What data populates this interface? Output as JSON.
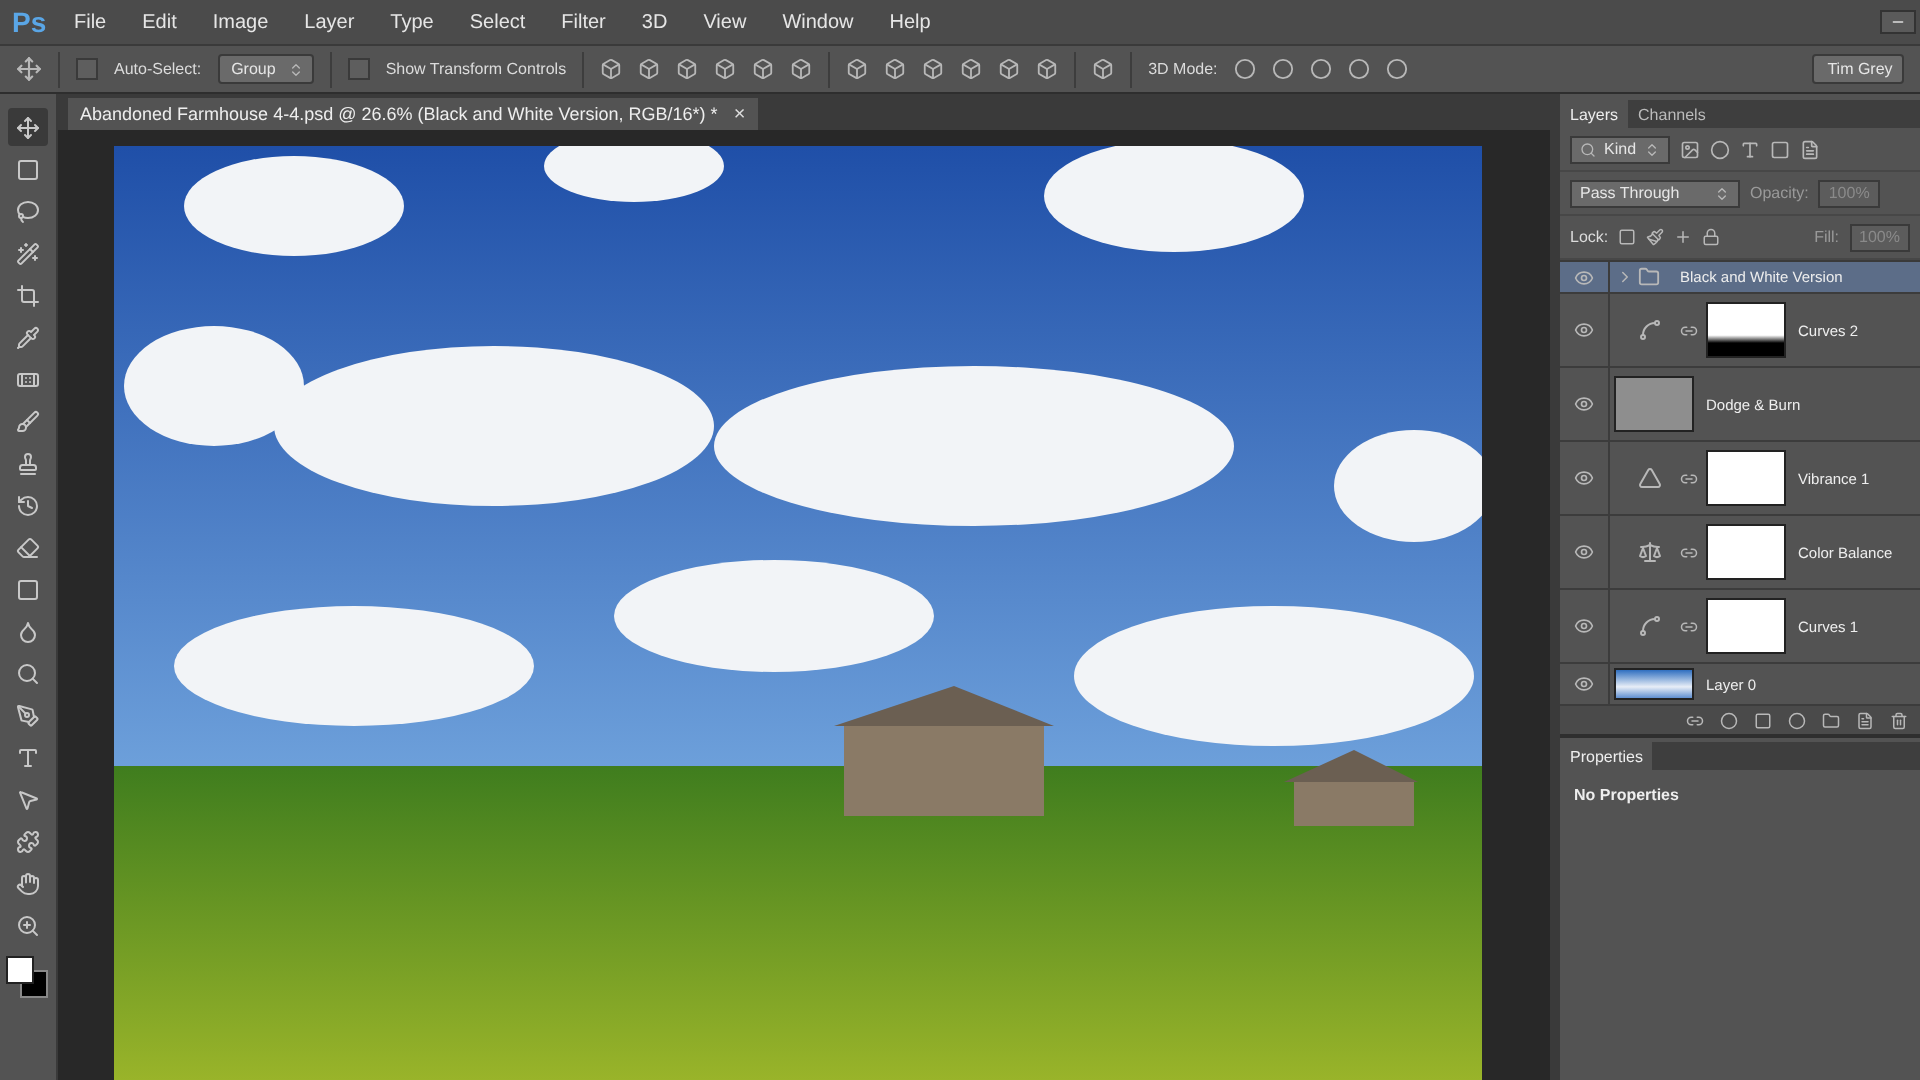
{
  "menu_bar": {
    "logo": "Ps",
    "items": [
      "File",
      "Edit",
      "Image",
      "Layer",
      "Type",
      "Select",
      "Filter",
      "3D",
      "View",
      "Window",
      "Help"
    ]
  },
  "options_bar": {
    "auto_select": {
      "label": "Auto-Select:",
      "checked": false
    },
    "target": "Group",
    "transform_controls": {
      "label": "Show Transform Controls",
      "checked": false
    },
    "mode_label": "3D Mode:",
    "workspace": "Tim Grey"
  },
  "document_tab": {
    "title": "Abandoned Farmhouse 4-4.psd @ 26.6% (Black and White Version, RGB/16*) *",
    "close": "×"
  },
  "tools": [
    {
      "kind": "move",
      "selected": true
    },
    {
      "kind": "marquee",
      "selected": false
    },
    {
      "kind": "lasso",
      "selected": false
    },
    {
      "kind": "brush-select",
      "selected": false
    },
    {
      "kind": "crop",
      "selected": false
    },
    {
      "kind": "eyedropper",
      "selected": false
    },
    {
      "kind": "bandage",
      "selected": false
    },
    {
      "kind": "brush",
      "selected": false
    },
    {
      "kind": "stamp",
      "selected": false
    },
    {
      "kind": "history",
      "selected": false
    },
    {
      "kind": "eraser",
      "selected": false
    },
    {
      "kind": "gradient",
      "selected": false
    },
    {
      "kind": "drop",
      "selected": false
    },
    {
      "kind": "dodge",
      "selected": false
    },
    {
      "kind": "pen",
      "selected": false
    },
    {
      "kind": "type",
      "selected": false
    },
    {
      "kind": "arrow",
      "selected": false
    },
    {
      "kind": "shape",
      "selected": false
    },
    {
      "kind": "hand",
      "selected": false
    },
    {
      "kind": "zoom",
      "selected": false
    }
  ],
  "layers_panel": {
    "tabs": [
      {
        "label": "Layers",
        "selected": true
      },
      {
        "label": "Channels",
        "selected": false
      }
    ],
    "filter": "Kind",
    "blend_mode": "Pass Through",
    "opacity_label": "Opacity:",
    "opacity": "100%",
    "lock_label": "Lock:",
    "fill_label": "Fill:",
    "fill": "100%",
    "layers": [
      {
        "kind": "group",
        "name": "Black and White Version",
        "visible": true,
        "selected": true,
        "expanded": false
      },
      {
        "kind": "curves",
        "name": "Curves 2",
        "visible": true,
        "selected": false
      },
      {
        "kind": "pixel",
        "name": "Dodge & Burn",
        "visible": true,
        "selected": false
      },
      {
        "kind": "vibrance",
        "name": "Vibrance 1",
        "visible": true,
        "selected": false
      },
      {
        "kind": "color_balance",
        "name": "Color Balance",
        "visible": true,
        "selected": false
      },
      {
        "kind": "curves",
        "name": "Curves 1",
        "visible": true,
        "selected": false
      },
      {
        "kind": "photo",
        "name": "Layer 0",
        "visible": true,
        "selected": false
      }
    ]
  },
  "properties_panel": {
    "tab": "Properties",
    "message": "No Properties"
  }
}
